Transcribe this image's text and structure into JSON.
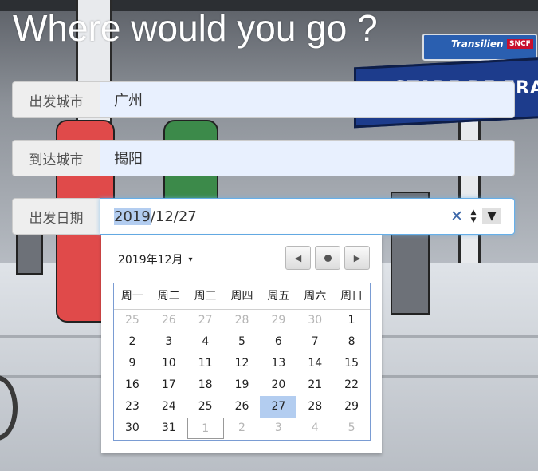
{
  "page": {
    "title": "Where would you go ?"
  },
  "background": {
    "station_sign": "STADE DE FRANC",
    "brand_sign": "Transilien",
    "brand_badge": "SNCF"
  },
  "form": {
    "departure": {
      "label": "出发城市",
      "value": "广州"
    },
    "arrival": {
      "label": "到达城市",
      "value": "揭阳"
    },
    "date": {
      "label": "出发日期",
      "value_selected_part": "2019",
      "value_rest": "/12/27",
      "clear_icon": "clear-x-icon",
      "spin_up_icon": "spin-up-icon",
      "spin_down_icon": "spin-down-icon",
      "dropdown_icon": "dropdown-triangle-icon"
    }
  },
  "datepicker": {
    "month_label": "2019年12月",
    "month_caret": "▾",
    "nav": {
      "prev_icon": "chevron-left-icon",
      "today_icon": "dot-icon",
      "next_icon": "chevron-right-icon"
    },
    "weekdays": [
      "周一",
      "周二",
      "周三",
      "周四",
      "周五",
      "周六",
      "周日"
    ],
    "weeks": [
      [
        {
          "d": "25",
          "other": true
        },
        {
          "d": "26",
          "other": true
        },
        {
          "d": "27",
          "other": true
        },
        {
          "d": "28",
          "other": true
        },
        {
          "d": "29",
          "other": true
        },
        {
          "d": "30",
          "other": true
        },
        {
          "d": "1"
        }
      ],
      [
        {
          "d": "2"
        },
        {
          "d": "3"
        },
        {
          "d": "4"
        },
        {
          "d": "5"
        },
        {
          "d": "6"
        },
        {
          "d": "7"
        },
        {
          "d": "8"
        }
      ],
      [
        {
          "d": "9"
        },
        {
          "d": "10"
        },
        {
          "d": "11"
        },
        {
          "d": "12"
        },
        {
          "d": "13"
        },
        {
          "d": "14"
        },
        {
          "d": "15"
        }
      ],
      [
        {
          "d": "16"
        },
        {
          "d": "17"
        },
        {
          "d": "18"
        },
        {
          "d": "19"
        },
        {
          "d": "20"
        },
        {
          "d": "21"
        },
        {
          "d": "22"
        }
      ],
      [
        {
          "d": "23"
        },
        {
          "d": "24"
        },
        {
          "d": "25"
        },
        {
          "d": "26"
        },
        {
          "d": "27",
          "selected": true
        },
        {
          "d": "28"
        },
        {
          "d": "29"
        }
      ],
      [
        {
          "d": "30"
        },
        {
          "d": "31"
        },
        {
          "d": "1",
          "other": true,
          "today": true
        },
        {
          "d": "2",
          "other": true
        },
        {
          "d": "3",
          "other": true
        },
        {
          "d": "4",
          "other": true
        },
        {
          "d": "5",
          "other": true
        }
      ]
    ],
    "selected_color": "#b3cdf0",
    "border_color": "#7a9cd3"
  }
}
